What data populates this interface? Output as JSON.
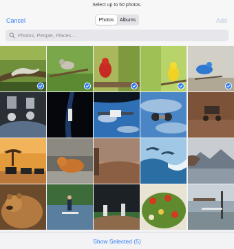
{
  "header": {
    "hint": "Select up to 50 photos.",
    "cancel_label": "Cancel",
    "add_label": "Add",
    "tabs": [
      {
        "label": "Photos",
        "active": true
      },
      {
        "label": "Albums",
        "active": false
      }
    ],
    "search_placeholder": "Photos, People, Places..."
  },
  "grid": {
    "rows": 4,
    "columns": 5,
    "photos": [
      {
        "subject": "lizard on branch",
        "selected": true
      },
      {
        "subject": "bird on branch",
        "selected": true
      },
      {
        "subject": "red cardinal",
        "selected": true
      },
      {
        "subject": "yellow bird",
        "selected": true
      },
      {
        "subject": "blue bird",
        "selected": true
      },
      {
        "subject": "astronaut in space",
        "selected": false
      },
      {
        "subject": "space shuttle",
        "selected": false
      },
      {
        "subject": "spacecraft over earth",
        "selected": false
      },
      {
        "subject": "satellite capsule",
        "selected": false
      },
      {
        "subject": "mars rover",
        "selected": false
      },
      {
        "subject": "zebras at sunset",
        "selected": false
      },
      {
        "subject": "tiger",
        "selected": false
      },
      {
        "subject": "desert landscape",
        "selected": false
      },
      {
        "subject": "dolphins and waves",
        "selected": false
      },
      {
        "subject": "mountain lake",
        "selected": false
      },
      {
        "subject": "brown bear",
        "selected": false
      },
      {
        "subject": "paddle boarder",
        "selected": false
      },
      {
        "subject": "baseball game",
        "selected": false
      },
      {
        "subject": "salad bowl",
        "selected": false
      },
      {
        "subject": "park bench",
        "selected": false
      }
    ]
  },
  "footer": {
    "show_selected_label": "Show Selected (5)"
  },
  "colors": {
    "accent": "#2f7cf6",
    "add_disabled": "#b9c7db"
  }
}
